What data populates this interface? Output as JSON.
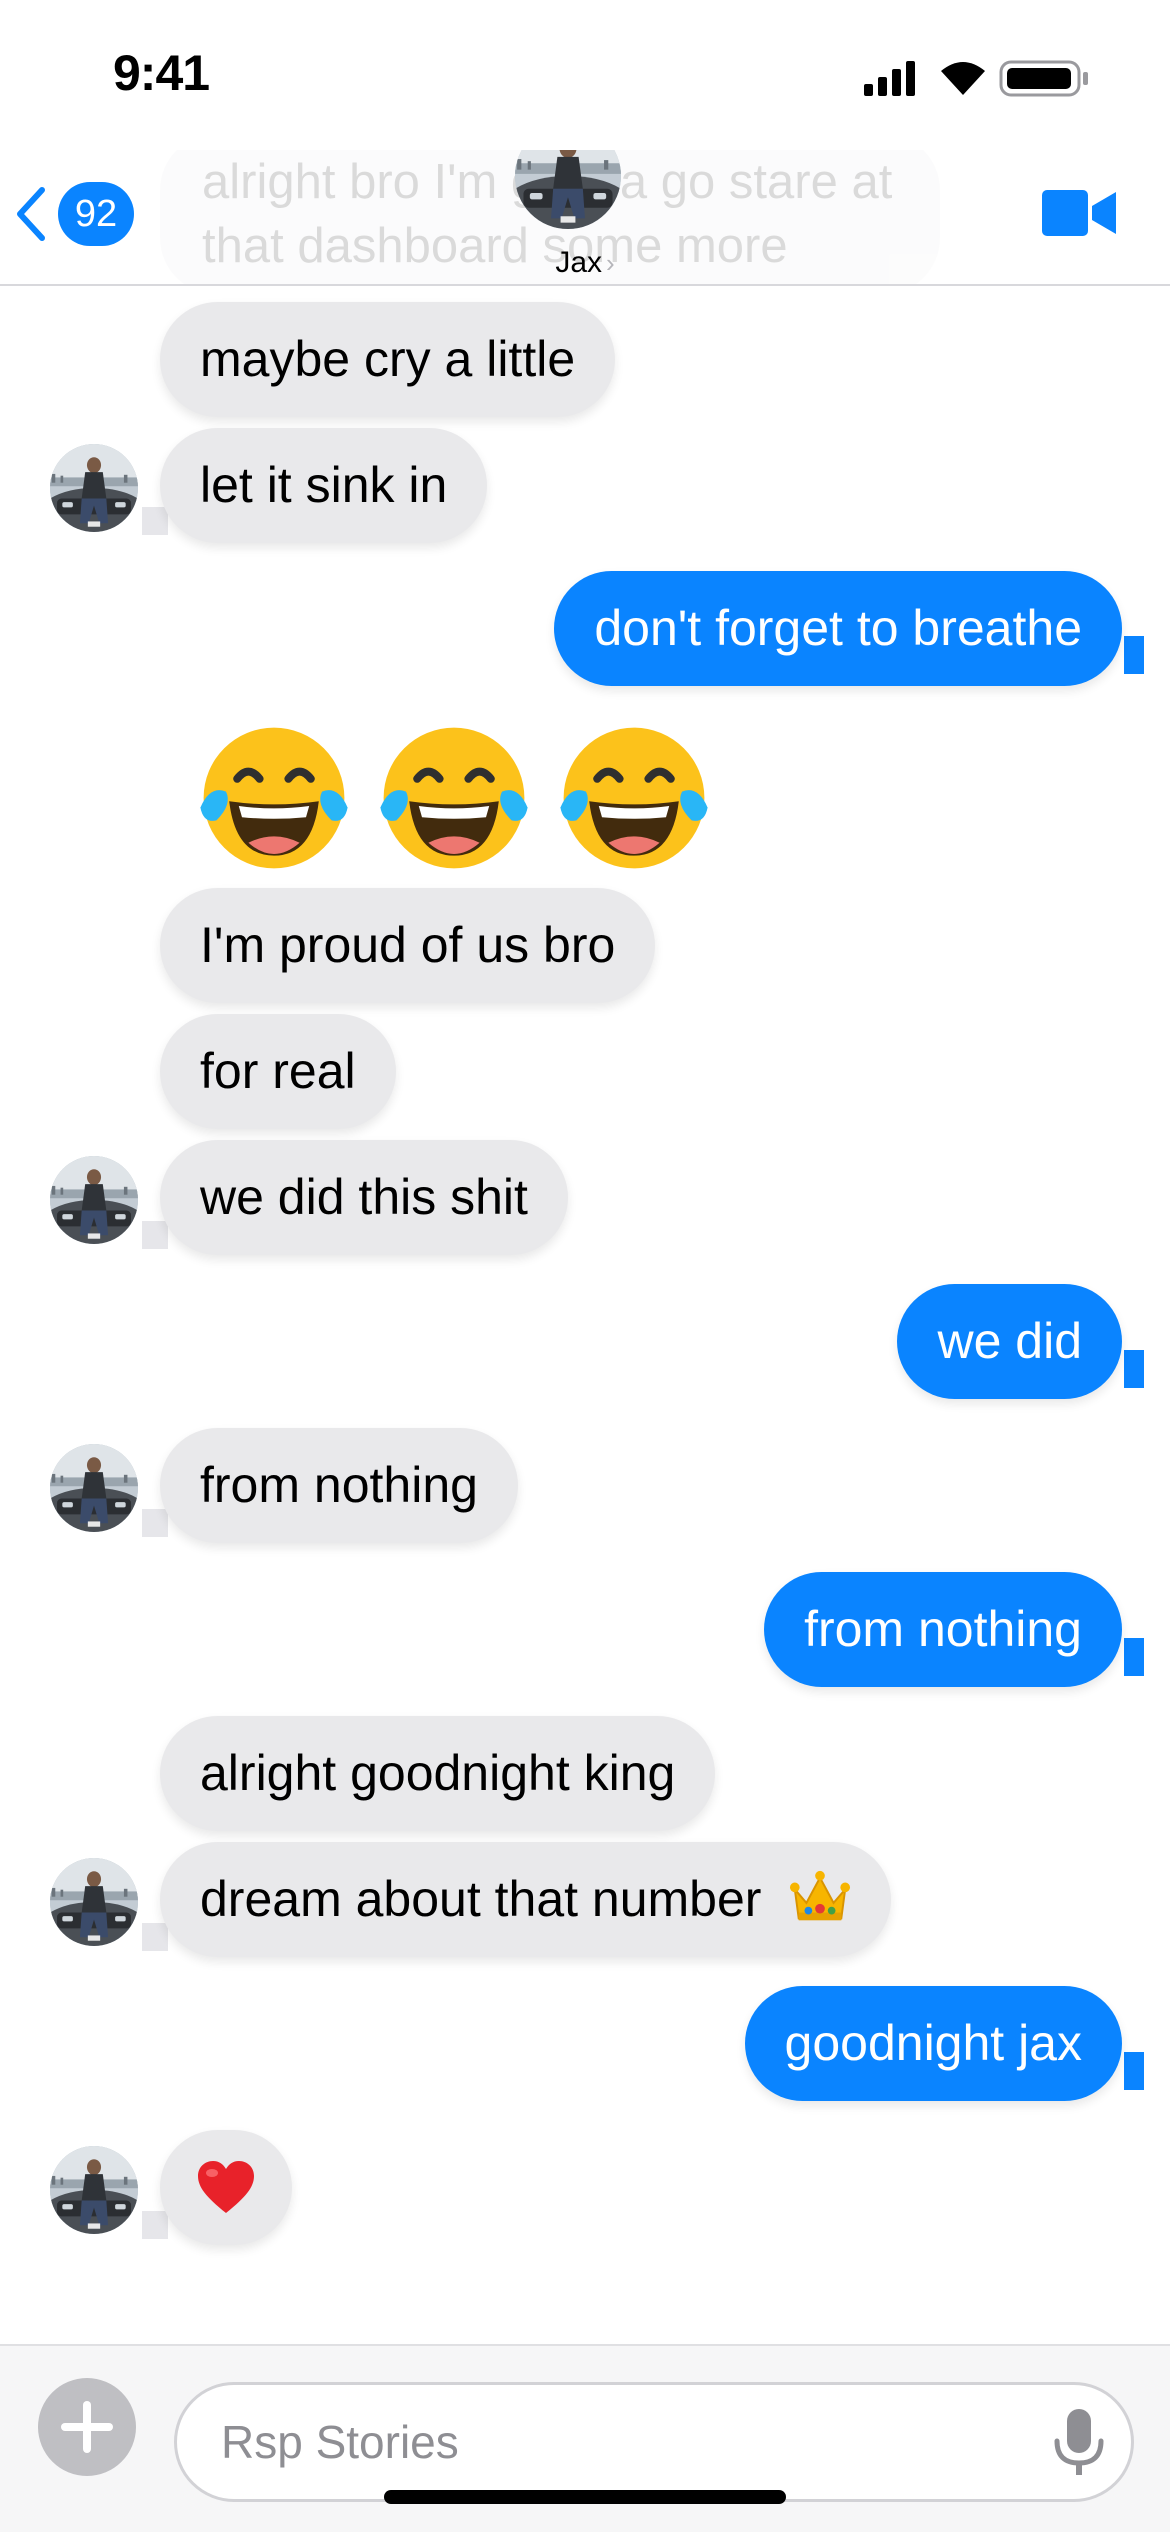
{
  "status_bar": {
    "time": "9:41",
    "icons": [
      "cellular-signal-icon",
      "wifi-icon",
      "battery-icon"
    ]
  },
  "header": {
    "faded_message_text": "alright bro I'm gonna go stare at that dashboard some more",
    "back_badge_count": "92",
    "contact_name": "Jax",
    "chevron": "›",
    "icons": [
      "back-chevron-icon",
      "video-camera-icon"
    ]
  },
  "messages": [
    {
      "from": "them",
      "text": "maybe cry a little"
    },
    {
      "from": "them",
      "text": "let it sink in"
    },
    {
      "from": "me",
      "text": "don't forget to breathe"
    },
    {
      "from": "them",
      "text": "😂😂😂",
      "kind": "jumbo-emoji",
      "icon": "tears-of-joy-emoji"
    },
    {
      "from": "them",
      "text": "I'm proud of us bro"
    },
    {
      "from": "them",
      "text": "for real"
    },
    {
      "from": "them",
      "text": "we did this shit"
    },
    {
      "from": "me",
      "text": "we did"
    },
    {
      "from": "them",
      "text": "from nothing"
    },
    {
      "from": "me",
      "text": "from nothing"
    },
    {
      "from": "them",
      "text": "alright goodnight king"
    },
    {
      "from": "them",
      "text": "dream about that number",
      "trailing_icon": "crown-emoji"
    },
    {
      "from": "me",
      "text": "goodnight jax"
    },
    {
      "from": "them",
      "text": "❤️",
      "kind": "emoji",
      "icon": "red-heart-emoji"
    }
  ],
  "composer": {
    "placeholder": "Rsp Stories",
    "value": "",
    "icons": [
      "plus-icon",
      "microphone-icon"
    ]
  },
  "colors": {
    "accent_blue": "#0a84ff",
    "incoming_bubble": "#e9e9eb",
    "background": "#ffffff"
  }
}
